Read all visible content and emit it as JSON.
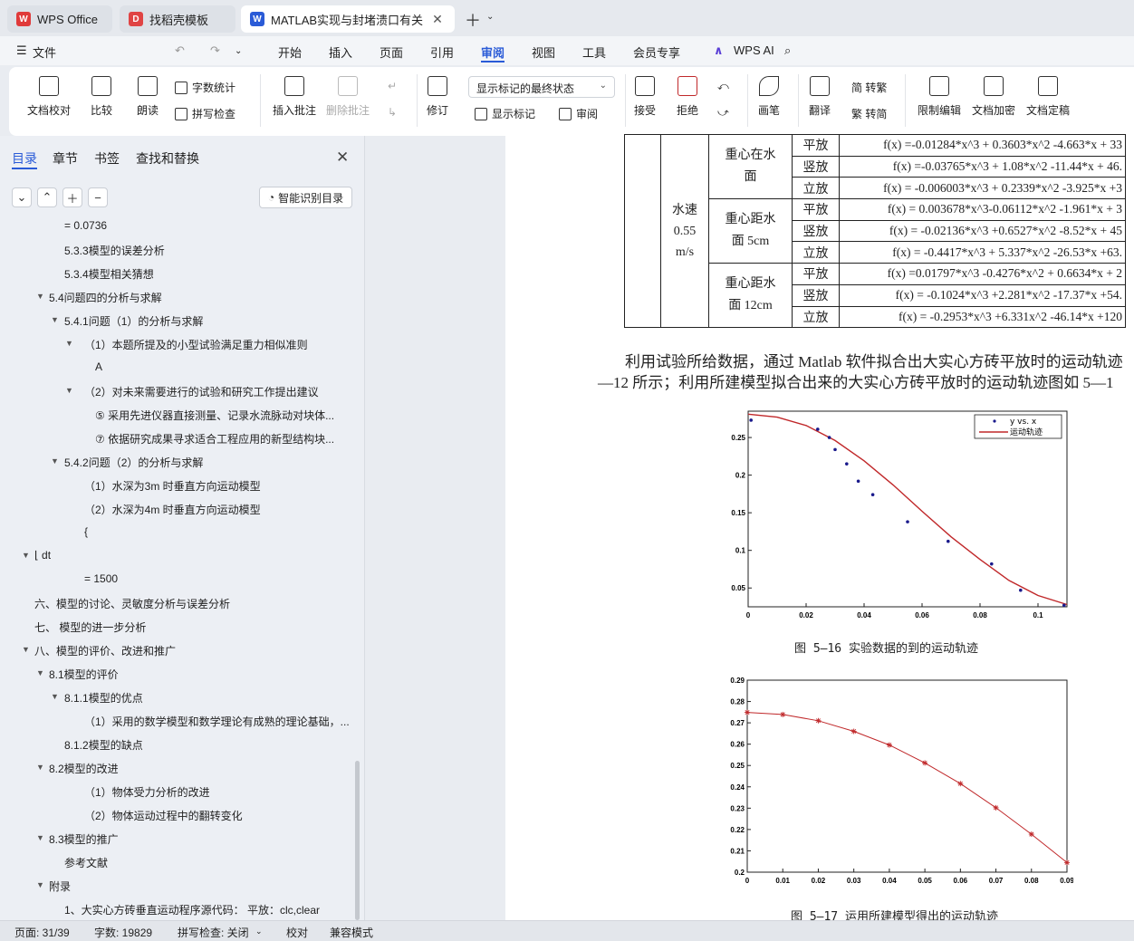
{
  "tabs": [
    {
      "label": "WPS Office"
    },
    {
      "label": "找稻壳模板"
    },
    {
      "label": "MATLAB实现与封堵溃口有关"
    }
  ],
  "menu": {
    "file": "文件",
    "items": [
      "开始",
      "插入",
      "页面",
      "引用",
      "审阅",
      "视图",
      "工具",
      "会员专享"
    ],
    "active": "审阅",
    "wps_ai": "WPS AI"
  },
  "ribbon": {
    "doc_proof": "文档校对",
    "compare": "比较",
    "read_aloud": "朗读",
    "word_count": "字数统计",
    "spell_check": "拼写检查",
    "insert_comment": "插入批注",
    "delete_comment": "删除批注",
    "revise": "修订",
    "markup_state": "显示标记的最终状态",
    "show_markup": "显示标记",
    "review": "审阅",
    "accept": "接受",
    "reject": "拒绝",
    "pen": "画笔",
    "translate": "翻译",
    "to_trad": "简 转繁",
    "to_simp": "繁 转简",
    "restrict_edit": "限制编辑",
    "encrypt": "文档加密",
    "finalize": "文档定稿"
  },
  "panel": {
    "tabs": [
      "目录",
      "章节",
      "书签",
      "查找和替换"
    ],
    "smart_toc": "智能识别目录",
    "toc": [
      {
        "text": "= 0.0736",
        "level": 2,
        "tri": ""
      },
      {
        "text": "5.3.3模型的误差分析",
        "level": 2,
        "tri": ""
      },
      {
        "text": "5.3.4模型相关猜想",
        "level": 2,
        "tri": ""
      },
      {
        "text": "5.4问题四的分析与求解",
        "level": 1,
        "tri": "▼"
      },
      {
        "text": "5.4.1问题（1）的分析与求解",
        "level": 2,
        "tri": "▼"
      },
      {
        "text": "（1）本题所提及的小型试验满足重力相似准则",
        "level": 3,
        "tri": "▼"
      },
      {
        "text": "A",
        "level": 4,
        "tri": ""
      },
      {
        "text": "（2）对未来需要进行的试验和研究工作提出建议",
        "level": 3,
        "tri": "▼"
      },
      {
        "text": "⑤ 采用先进仪器直接测量、记录水流脉动对块体...",
        "level": 4,
        "tri": ""
      },
      {
        "text": "⑦ 依据研究成果寻求适合工程应用的新型结构块...",
        "level": 4,
        "tri": ""
      },
      {
        "text": "5.4.2问题（2）的分析与求解",
        "level": 2,
        "tri": "▼"
      },
      {
        "text": "（1）水深为3m 时垂直方向运动模型",
        "level": 3,
        "tri": ""
      },
      {
        "text": "（2）水深为4m 时垂直方向运动模型",
        "level": 3,
        "tri": ""
      },
      {
        "text": "{",
        "level": 3,
        "tri": ""
      },
      {
        "text": "⌊ dt",
        "level": 0,
        "tri": "▼"
      },
      {
        "text": "= 1500",
        "level": 3,
        "tri": ""
      },
      {
        "text": "六、模型的讨论、灵敏度分析与误差分析",
        "level": 0,
        "tri": ""
      },
      {
        "text": "七、 模型的进一步分析",
        "level": 0,
        "tri": ""
      },
      {
        "text": "八、模型的评价、改进和推广",
        "level": 0,
        "tri": "▼"
      },
      {
        "text": "8.1模型的评价",
        "level": 1,
        "tri": "▼"
      },
      {
        "text": "8.1.1模型的优点",
        "level": 2,
        "tri": "▼"
      },
      {
        "text": "（1）采用的数学模型和数学理论有成熟的理论基础，...",
        "level": 3,
        "tri": ""
      },
      {
        "text": "8.1.2模型的缺点",
        "level": 2,
        "tri": ""
      },
      {
        "text": "8.2模型的改进",
        "level": 1,
        "tri": "▼"
      },
      {
        "text": "（1）物体受力分析的改进",
        "level": 3,
        "tri": ""
      },
      {
        "text": "（2）物体运动过程中的翻转变化",
        "level": 3,
        "tri": ""
      },
      {
        "text": "8.3模型的推广",
        "level": 1,
        "tri": "▼"
      },
      {
        "text": "参考文献",
        "level": 2,
        "tri": ""
      },
      {
        "text": "附录",
        "level": 1,
        "tri": "▼"
      },
      {
        "text": "1、大实心方砖垂直运动程序源代码：  平放：clc,clear",
        "level": 2,
        "tri": ""
      }
    ]
  },
  "doc": {
    "table": {
      "speed": "水速\n0.55\nm/s",
      "groups": [
        {
          "label": "重心在水\n面",
          "rows": [
            {
              "pos": "平放",
              "f": "f(x) =-0.01284*x^3 + 0.3603*x^2 -4.663*x + 33"
            },
            {
              "pos": "竖放",
              "f": "f(x) =-0.03765*x^3 + 1.08*x^2 -11.44*x + 46."
            },
            {
              "pos": "立放",
              "f": "f(x) = -0.006003*x^3 + 0.2339*x^2 -3.925*x +3"
            }
          ]
        },
        {
          "label": "重心距水\n面 5cm",
          "rows": [
            {
              "pos": "平放",
              "f": "f(x) = 0.003678*x^3-0.06112*x^2 -1.961*x + 3"
            },
            {
              "pos": "竖放",
              "f": "f(x) = -0.02136*x^3 +0.6527*x^2 -8.52*x + 45"
            },
            {
              "pos": "立放",
              "f": "f(x) = -0.4417*x^3 + 5.337*x^2 -26.53*x +63."
            }
          ]
        },
        {
          "label": "重心距水\n面 12cm",
          "rows": [
            {
              "pos": "平放",
              "f": "f(x) =0.01797*x^3 -0.4276*x^2 + 0.6634*x + 2"
            },
            {
              "pos": "竖放",
              "f": "f(x) = -0.1024*x^3 +2.281*x^2 -17.37*x +54."
            },
            {
              "pos": "立放",
              "f": "f(x) = -0.2953*x^3 +6.331x^2 -46.14*x +120"
            }
          ]
        }
      ]
    },
    "para_line1": "利用试验所给数据，通过 Matlab 软件拟合出大实心方砖平放时的运动轨迹",
    "para_line2": "—12 所示；利用所建模型拟合出来的大实心方砖平放时的运动轨迹图如  5—1",
    "caption1": "图 5—16 实验数据的到的运动轨迹",
    "caption2": "图 5—17 运用所建模型得出的运动轨迹"
  },
  "chart_data": [
    {
      "type": "scatter",
      "legend": [
        "y vs. x",
        "运动轨迹"
      ],
      "legend_position": "top-right",
      "xlim": [
        0,
        0.11
      ],
      "ylim": [
        0.025,
        0.285
      ],
      "xticks": [
        "0",
        "0.02",
        "0.04",
        "0.06",
        "0.08",
        "0.1"
      ],
      "yticks": [
        "0.05",
        "0.1",
        "0.15",
        "0.2",
        "0.25"
      ],
      "points": [
        {
          "x": 0.001,
          "y": 0.273
        },
        {
          "x": 0.024,
          "y": 0.261
        },
        {
          "x": 0.028,
          "y": 0.25
        },
        {
          "x": 0.03,
          "y": 0.234
        },
        {
          "x": 0.034,
          "y": 0.215
        },
        {
          "x": 0.038,
          "y": 0.192
        },
        {
          "x": 0.043,
          "y": 0.174
        },
        {
          "x": 0.055,
          "y": 0.138
        },
        {
          "x": 0.069,
          "y": 0.112
        },
        {
          "x": 0.084,
          "y": 0.082
        },
        {
          "x": 0.094,
          "y": 0.047
        },
        {
          "x": 0.109,
          "y": 0.027
        }
      ],
      "curve": [
        {
          "x": 0.0,
          "y": 0.281
        },
        {
          "x": 0.01,
          "y": 0.277
        },
        {
          "x": 0.02,
          "y": 0.266
        },
        {
          "x": 0.03,
          "y": 0.246
        },
        {
          "x": 0.04,
          "y": 0.219
        },
        {
          "x": 0.05,
          "y": 0.187
        },
        {
          "x": 0.06,
          "y": 0.152
        },
        {
          "x": 0.07,
          "y": 0.118
        },
        {
          "x": 0.08,
          "y": 0.088
        },
        {
          "x": 0.09,
          "y": 0.06
        },
        {
          "x": 0.1,
          "y": 0.04
        },
        {
          "x": 0.11,
          "y": 0.028
        }
      ],
      "colors": {
        "points": "#1a1a8c",
        "curve": "#c0282a"
      }
    },
    {
      "type": "line",
      "xlim": [
        0,
        0.09
      ],
      "ylim": [
        0.2,
        0.29
      ],
      "xticks": [
        "0",
        "0.01",
        "0.02",
        "0.03",
        "0.04",
        "0.05",
        "0.06",
        "0.07",
        "0.08",
        "0.09"
      ],
      "yticks": [
        "0.2",
        "0.21",
        "0.22",
        "0.23",
        "0.24",
        "0.25",
        "0.26",
        "0.27",
        "0.28",
        "0.29"
      ],
      "x": [
        0,
        0.01,
        0.02,
        0.03,
        0.04,
        0.05,
        0.06,
        0.07,
        0.08,
        0.09
      ],
      "y": [
        0.2749,
        0.2739,
        0.271,
        0.266,
        0.2596,
        0.2512,
        0.2415,
        0.2302,
        0.2178,
        0.2045
      ],
      "colors": {
        "line": "#c0282a"
      }
    }
  ],
  "status": {
    "page": "页面: 31/39",
    "words": "字数: 19829",
    "spell": "拼写检查: 关闭",
    "proof": "校对",
    "compat": "兼容模式"
  }
}
